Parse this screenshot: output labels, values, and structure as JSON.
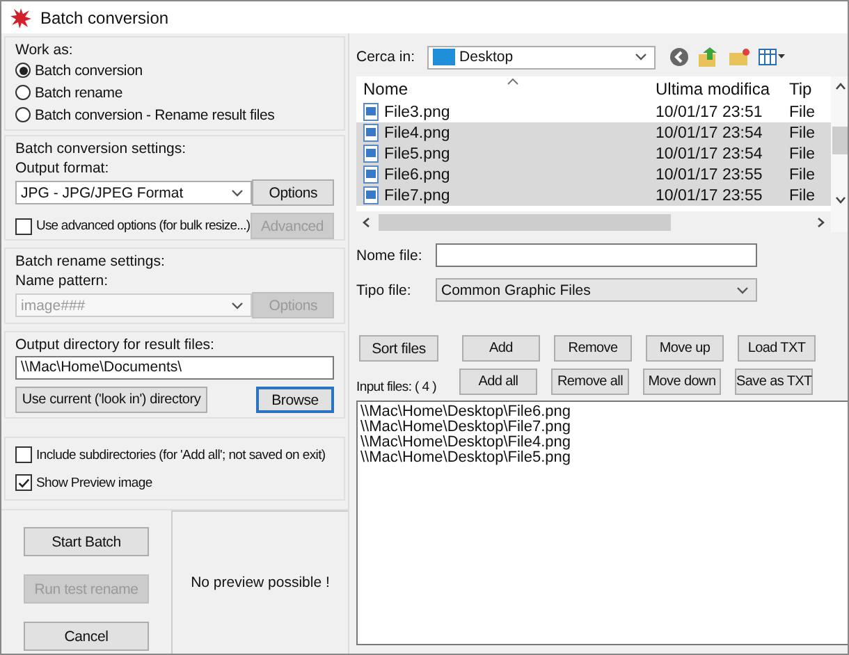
{
  "window": {
    "title": "Batch conversion"
  },
  "work_as": {
    "label": "Work as:",
    "options": [
      {
        "label": "Batch conversion",
        "selected": true
      },
      {
        "label": "Batch rename",
        "selected": false
      },
      {
        "label": "Batch conversion - Rename result files",
        "selected": false
      }
    ]
  },
  "conversion_settings": {
    "label": "Batch conversion settings:",
    "output_format_label": "Output format:",
    "output_format": "JPG - JPG/JPEG Format",
    "options_button": {
      "label": "Options",
      "disabled": false
    },
    "advanced_checkbox": {
      "label": "Use advanced options (for bulk resize...)",
      "checked": false
    },
    "advanced_button": {
      "label": "Advanced",
      "disabled": true
    }
  },
  "rename_settings": {
    "label": "Batch rename settings:",
    "name_pattern_label": "Name pattern:",
    "name_pattern": {
      "value": "image###",
      "disabled": true
    },
    "options_button": {
      "label": "Options",
      "disabled": true
    }
  },
  "output_directory": {
    "label": "Output directory for result files:",
    "value": "\\\\Mac\\Home\\Documents\\",
    "use_current_button": {
      "label": "Use current ('look in') directory",
      "focused": false
    },
    "browse_button": {
      "label": "Browse",
      "focused": true
    }
  },
  "options": [
    {
      "label": "Include subdirectories (for 'Add all'; not saved on exit)",
      "checked": false
    },
    {
      "label": "Show Preview image",
      "checked": true
    }
  ],
  "actions": [
    {
      "label": "Start Batch",
      "disabled": false
    },
    {
      "label": "Run test rename",
      "disabled": true
    },
    {
      "label": "Cancel",
      "disabled": false
    }
  ],
  "preview": {
    "message": "No preview possible !"
  },
  "file_browser": {
    "look_in_label": "Cerca in:",
    "look_in_value": "Desktop",
    "columns": [
      "Nome",
      "Ultima modifica",
      "Tip"
    ],
    "files": [
      {
        "name": "File3.png",
        "modified": "10/01/17 23:51",
        "type": "File",
        "selected": false
      },
      {
        "name": "File4.png",
        "modified": "10/01/17 23:54",
        "type": "File",
        "selected": true
      },
      {
        "name": "File5.png",
        "modified": "10/01/17 23:54",
        "type": "File",
        "selected": true
      },
      {
        "name": "File6.png",
        "modified": "10/01/17 23:55",
        "type": "File",
        "selected": true
      },
      {
        "name": "File7.png",
        "modified": "10/01/17 23:55",
        "type": "File",
        "selected": true
      }
    ],
    "file_name_label": "Nome file:",
    "file_type_label": "Tipo file:",
    "file_type_value": "Common Graphic Files"
  },
  "file_buttons": [
    [
      {
        "label": "Sort files"
      },
      {
        "label": "Add"
      },
      {
        "label": "Remove"
      },
      {
        "label": "Move up"
      },
      {
        "label": "Load TXT"
      }
    ],
    [
      {
        "label": "Add all"
      },
      {
        "label": "Remove all"
      },
      {
        "label": "Move down"
      },
      {
        "label": "Save as TXT"
      }
    ]
  ],
  "input_files": {
    "label": "Input files: ( 4 )",
    "items": [
      "\\\\Mac\\Home\\Desktop\\File6.png",
      "\\\\Mac\\Home\\Desktop\\File7.png",
      "\\\\Mac\\Home\\Desktop\\File4.png",
      "\\\\Mac\\Home\\Desktop\\File5.png"
    ]
  }
}
